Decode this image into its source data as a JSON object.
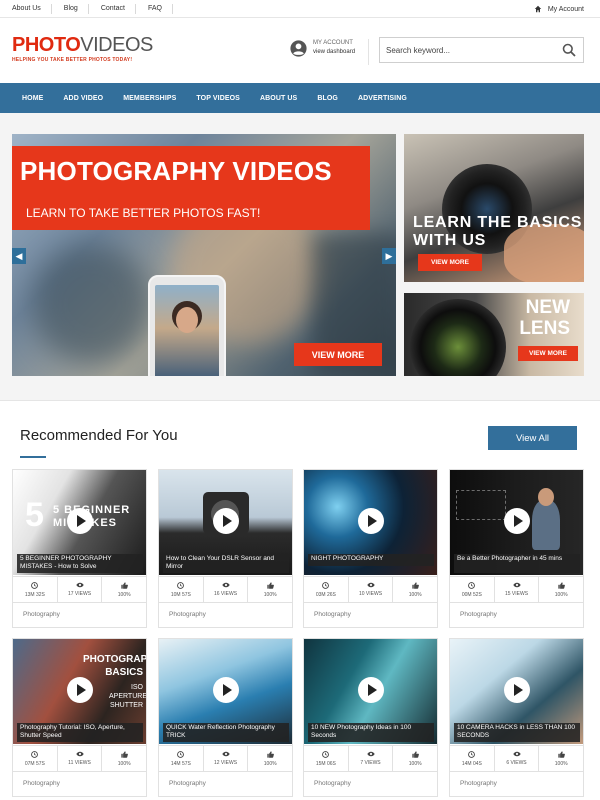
{
  "topbar": {
    "links": [
      "About Us",
      "Blog",
      "Contact",
      "FAQ"
    ],
    "account_label": "My Account"
  },
  "header": {
    "logo_main": "PHOTO",
    "logo_second": "VIDEOS",
    "tagline": "HELPING YOU TAKE BETTER PHOTOS TODAY!",
    "account_title": "MY ACCOUNT",
    "account_sub": "view dashboard",
    "search_placeholder": "Search keyword..."
  },
  "nav": [
    "HOME",
    "ADD VIDEO",
    "MEMBERSHIPS",
    "TOP VIDEOS",
    "ABOUT US",
    "BLOG",
    "ADVERTISING"
  ],
  "hero": {
    "title": "PHOTOGRAPHY VIDEOS",
    "subtitle": "LEARN TO TAKE BETTER PHOTOS FAST!",
    "button": "VIEW MORE",
    "arrow_left": "◀",
    "arrow_right": "▶"
  },
  "side_promos": [
    {
      "title": "LEARN THE BASICS WITH US",
      "button": "VIEW MORE"
    },
    {
      "title": "NEW LENS",
      "button": "VIEW MORE"
    }
  ],
  "recommended": {
    "title": "Recommended For You",
    "view_all": "View All"
  },
  "videos": [
    {
      "caption": "5 BEGINNER PHOTOGRAPHY MISTAKES - How to Solve",
      "duration": "13M 32S",
      "views": "17 VIEWS",
      "likes": "100%",
      "category": "Photography",
      "overlay": "5 BEGINNER MISTAKES"
    },
    {
      "caption": "How to Clean Your DSLR Sensor and Mirror",
      "duration": "10M 57S",
      "views": "16 VIEWS",
      "likes": "100%",
      "category": "Photography"
    },
    {
      "caption": "NIGHT PHOTOGRAPHY",
      "duration": "03M 26S",
      "views": "10 VIEWS",
      "likes": "100%",
      "category": "Photography"
    },
    {
      "caption": "Be a Better Photographer in 45 mins",
      "duration": "00M 52S",
      "views": "15 VIEWS",
      "likes": "100%",
      "category": "Photography"
    },
    {
      "caption": "Photography Tutorial: ISO, Aperture, Shutter Speed",
      "duration": "07M 57S",
      "views": "11 VIEWS",
      "likes": "100%",
      "category": "Photography",
      "overlay": "PHOTOGRAPHY BASICS",
      "overlay2": "ISO APERTURE SHUTTER"
    },
    {
      "caption": "QUICK Water Reflection Photography TRICK",
      "duration": "14M 57S",
      "views": "12 VIEWS",
      "likes": "100%",
      "category": "Photography"
    },
    {
      "caption": "10 NEW Photography Ideas in 100 Seconds",
      "duration": "15M 06S",
      "views": "7 VIEWS",
      "likes": "100%",
      "category": "Photography"
    },
    {
      "caption": "10 CAMERA HACKS in LESS THAN 100 SECONDS",
      "duration": "14M 04S",
      "views": "6 VIEWS",
      "likes": "100%",
      "category": "Photography"
    }
  ],
  "colors": {
    "brand_red": "#e6371b",
    "nav_blue": "#336f9b"
  }
}
